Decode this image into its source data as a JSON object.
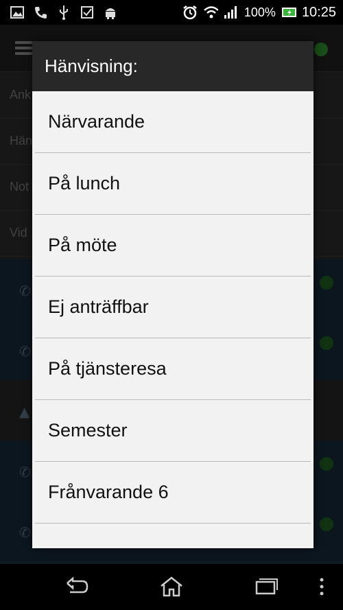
{
  "status_bar": {
    "battery_percent": "100%",
    "time": "10:25",
    "icons": [
      "gallery-icon",
      "call-icon",
      "usb-icon",
      "checkbox-icon",
      "android-icon",
      "alarm-icon",
      "wifi-icon",
      "signal-icon",
      "battery-icon"
    ]
  },
  "background_app": {
    "rows": [
      "Ank",
      "Hän",
      "Not",
      "Vid"
    ]
  },
  "dialog": {
    "title": "Hänvisning:",
    "options": [
      "Närvarande",
      "På lunch",
      "På möte",
      "Ej anträffbar",
      "På tjänsteresa",
      "Semester",
      "Frånvarande 6"
    ]
  },
  "nav_bar": {
    "icons": [
      "back-icon",
      "home-icon",
      "recent-apps-icon",
      "overflow-menu-icon"
    ]
  },
  "colors": {
    "dialog_bg": "#f2f2f2",
    "dialog_title_bg": "#282828",
    "status_dot": "#2f8b2f"
  }
}
